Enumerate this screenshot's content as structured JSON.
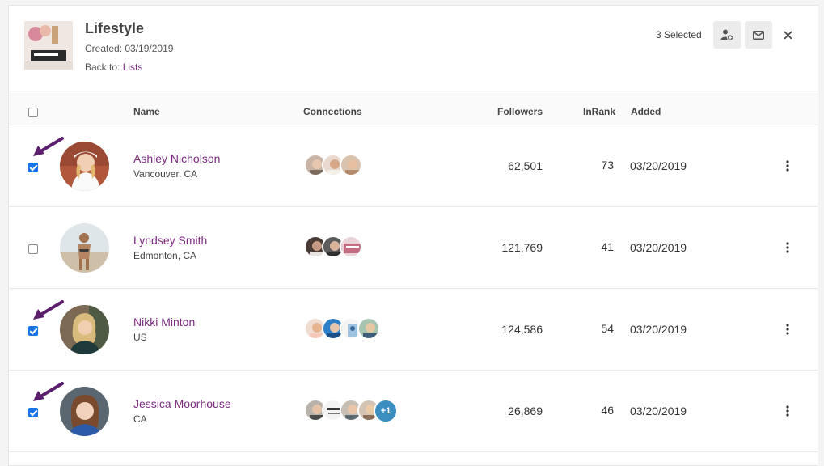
{
  "list": {
    "title": "Lifestyle",
    "created": "Created: 03/19/2019",
    "back_prefix": "Back to: ",
    "back_link": "Lists"
  },
  "selection": {
    "count_label": "3 Selected"
  },
  "columns": {
    "name": "Name",
    "connections": "Connections",
    "followers": "Followers",
    "inrank": "InRank",
    "added": "Added"
  },
  "rows": [
    {
      "name": "Ashley Nicholson",
      "location": "Vancouver, CA",
      "followers": "62,501",
      "inrank": "73",
      "added": "03/20/2019",
      "checked": true
    },
    {
      "name": "Lyndsey Smith",
      "location": "Edmonton, CA",
      "followers": "121,769",
      "inrank": "41",
      "added": "03/20/2019",
      "checked": false
    },
    {
      "name": "Nikki Minton",
      "location": "US",
      "followers": "124,586",
      "inrank": "54",
      "added": "03/20/2019",
      "checked": true
    },
    {
      "name": "Jessica Moorhouse",
      "location": "CA",
      "followers": "26,869",
      "inrank": "46",
      "added": "03/20/2019",
      "checked": true,
      "extra_connections": "+1"
    }
  ],
  "colors": {
    "accent": "#7b2a80",
    "checkbox": "#1a73e8",
    "badge": "#3a8fc0"
  }
}
